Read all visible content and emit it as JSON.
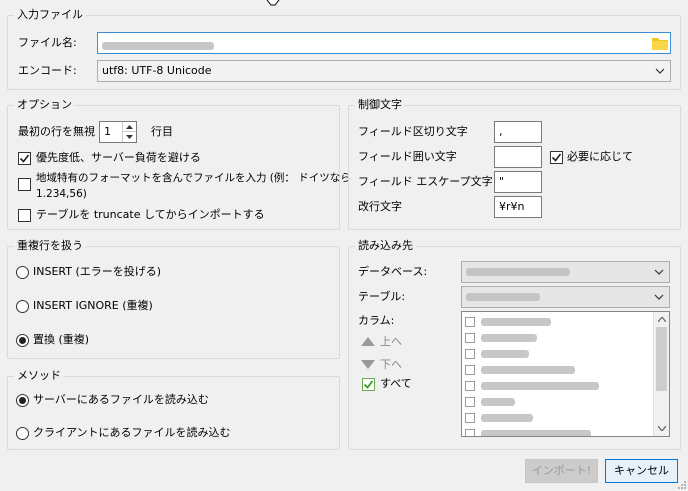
{
  "input_file": {
    "group_title": "入力ファイル",
    "filename_label": "ファイル名:",
    "encoding_label": "エンコード:",
    "encoding_value": "utf8: UTF-8 Unicode",
    "browse_icon": "folder-icon"
  },
  "options": {
    "group_title": "オプション",
    "ignore_first_label": "最初の行を無視",
    "ignore_first_value": "1",
    "rows_suffix": "行目",
    "low_priority_label": "優先度低、サーバー負荷を避ける",
    "low_priority_checked": true,
    "locale_format_label_line1": "地域特有のフォーマットを含んでファイルを入力 (例： ドイツなら",
    "locale_format_label_line2": "1.234,56)",
    "locale_format_checked": false,
    "truncate_label": "テーブルを truncate してからインポートする",
    "truncate_checked": false
  },
  "control_chars": {
    "group_title": "制御文字",
    "field_sep_label": "フィールド区切り文字",
    "field_sep_value": ",",
    "field_enclose_label": "フィールド囲い文字",
    "field_enclose_value": "",
    "as_needed_label": "必要に応じて",
    "as_needed_checked": true,
    "field_escape_label": "フィールド エスケープ文字",
    "field_escape_value": "\"",
    "newline_label": "改行文字",
    "newline_value": "¥r¥n"
  },
  "duplicates": {
    "group_title": "重複行を扱う",
    "options": [
      {
        "label": "INSERT (エラーを投げる)",
        "selected": false
      },
      {
        "label": "INSERT IGNORE (重複)",
        "selected": false
      },
      {
        "label": "置換 (重複)",
        "selected": true
      }
    ]
  },
  "method": {
    "group_title": "メソッド",
    "options": [
      {
        "label": "サーバーにあるファイルを読み込む",
        "selected": true
      },
      {
        "label": "クライアントにあるファイルを読み込む",
        "selected": false
      }
    ]
  },
  "target": {
    "group_title": "読み込み先",
    "database_label": "データベース:",
    "table_label": "テーブル:",
    "columns_label": "カラム:",
    "up_label": "上へ",
    "down_label": "下へ",
    "all_label": "すべて",
    "all_checked": true
  },
  "buttons": {
    "import_label": "インポート!",
    "cancel_label": "キャンセル"
  }
}
